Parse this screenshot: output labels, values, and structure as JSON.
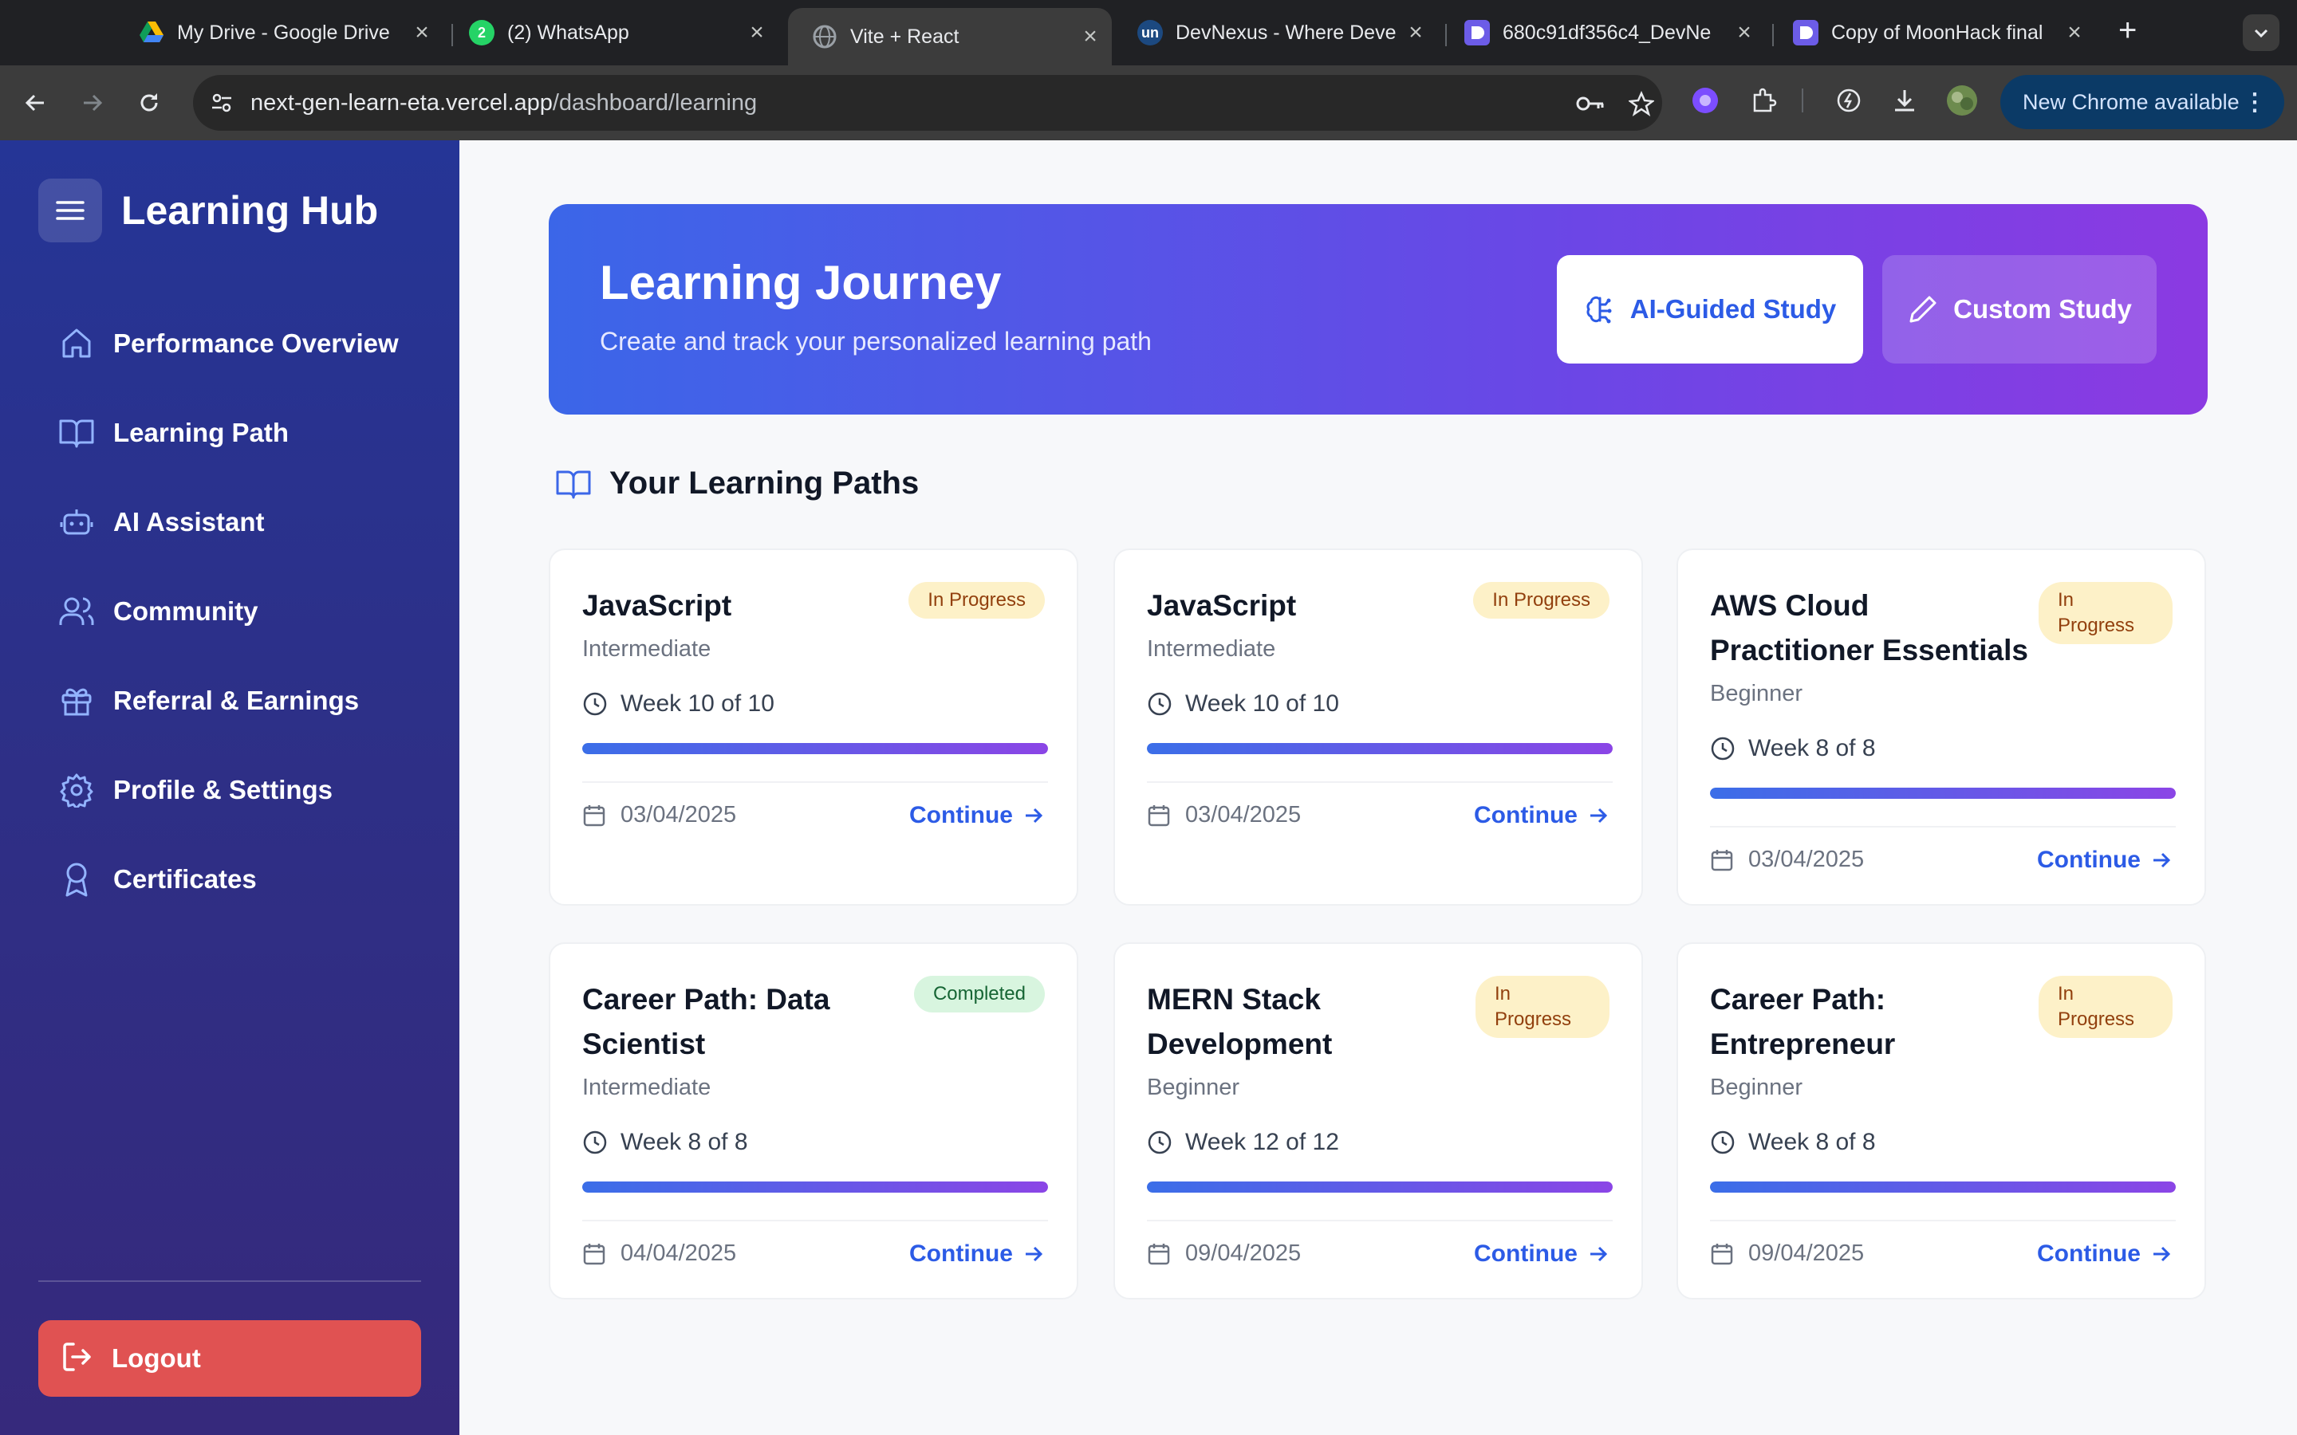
{
  "browser": {
    "tabs": [
      {
        "title": "My Drive - Google Drive",
        "icon": "google-drive-icon"
      },
      {
        "title": "(2) WhatsApp",
        "icon": "whatsapp-icon",
        "badge": "2"
      },
      {
        "title": "Vite + React",
        "icon": "globe-icon"
      },
      {
        "title": "DevNexus - Where Deve",
        "icon": "unstop-icon",
        "icon_text": "un"
      },
      {
        "title": "680c91df356c4_DevNe",
        "icon": "devpost-icon"
      },
      {
        "title": "Copy of MoonHack final",
        "icon": "devpost-icon"
      }
    ],
    "url_host": "next-gen-learn-eta.vercel.app",
    "url_path": "/dashboard/learning",
    "update_label": "New Chrome available"
  },
  "sidebar": {
    "brand": "Learning Hub",
    "items": [
      {
        "label": "Performance Overview",
        "icon": "home-icon"
      },
      {
        "label": "Learning Path",
        "icon": "book-open-icon"
      },
      {
        "label": "AI Assistant",
        "icon": "bot-icon"
      },
      {
        "label": "Community",
        "icon": "users-icon"
      },
      {
        "label": "Referral & Earnings",
        "icon": "gift-icon"
      },
      {
        "label": "Profile & Settings",
        "icon": "gear-icon"
      },
      {
        "label": "Certificates",
        "icon": "award-icon"
      }
    ],
    "logout_label": "Logout"
  },
  "hero": {
    "title": "Learning Journey",
    "subtitle": "Create and track your personalized learning path",
    "ai_button": "AI-Guided Study",
    "custom_button": "Custom Study"
  },
  "paths": {
    "heading": "Your Learning Paths",
    "continue_label": "Continue",
    "cards": [
      {
        "title": "JavaScript",
        "level": "Intermediate",
        "status": "In Progress",
        "week": "Week 10 of 10",
        "date": "03/04/2025",
        "progress": 1.0
      },
      {
        "title": "JavaScript",
        "level": "Intermediate",
        "status": "In Progress",
        "week": "Week 10 of 10",
        "date": "03/04/2025",
        "progress": 1.0
      },
      {
        "title": "AWS Cloud Practitioner Essentials",
        "level": "Beginner",
        "status": "In Progress",
        "week": "Week 8 of 8",
        "date": "03/04/2025",
        "progress": 1.0
      },
      {
        "title": "Career Path: Data Scientist",
        "level": "Intermediate",
        "status": "Completed",
        "week": "Week 8 of 8",
        "date": "04/04/2025",
        "progress": 1.0
      },
      {
        "title": "MERN Stack Development",
        "level": "Beginner",
        "status": "In Progress",
        "week": "Week 12 of 12",
        "date": "09/04/2025",
        "progress": 1.0
      },
      {
        "title": "Career Path: Entrepreneur",
        "level": "Beginner",
        "status": "In Progress",
        "week": "Week 8 of 8",
        "date": "09/04/2025",
        "progress": 1.0
      }
    ]
  },
  "colors": {
    "accent": "#2c5be6",
    "sidebar": "#2e2f86",
    "logout": "#e05252",
    "in_progress_badge": "#fdf1c8",
    "completed_badge": "#d8f5df"
  }
}
